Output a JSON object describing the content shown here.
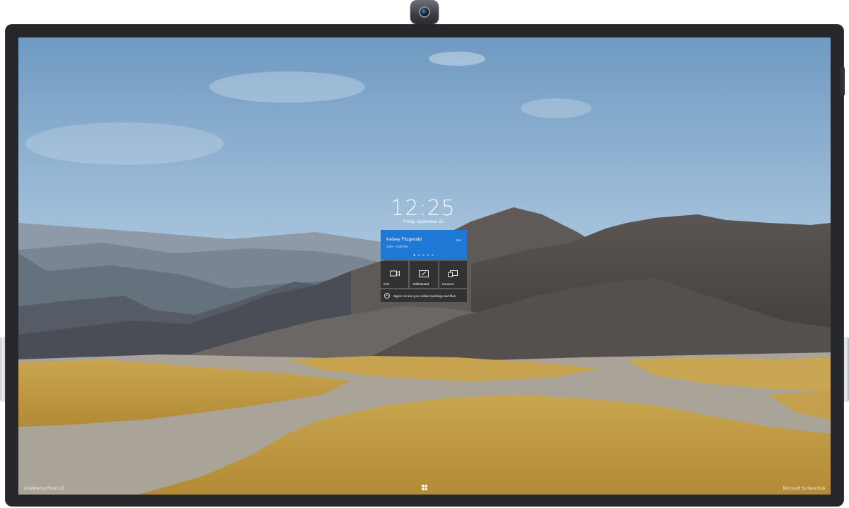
{
  "lock_screen": {
    "time": "12:25",
    "date": "Friday, September 25"
  },
  "meeting": {
    "organizer": "Kelsey Fitzgerald",
    "time_range": "3:00 – 4:00 PM",
    "join_label": "Join"
  },
  "actions": [
    {
      "label": "Call",
      "icon": "video-camera-icon"
    },
    {
      "label": "Whiteboard",
      "icon": "whiteboard-pen-icon"
    },
    {
      "label": "Connect",
      "icon": "screen-connect-icon"
    }
  ],
  "signin": {
    "text": "Sign in to see your online meetings and files",
    "icon": "person-icon"
  },
  "footer": {
    "room_name": "Conference Room 23",
    "brand": "Microsoft Surface Hub",
    "start_icon": "windows-icon"
  },
  "colors": {
    "accent": "#1e78d4",
    "bezel": "#25272b",
    "tile": "#28282c"
  }
}
